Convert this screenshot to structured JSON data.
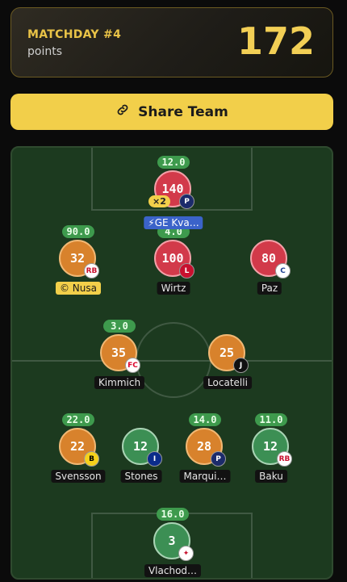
{
  "summary": {
    "matchday": "MATCHDAY #4",
    "label": "points",
    "points": "172"
  },
  "share": {
    "label": "Share Team",
    "icon": "link-icon"
  },
  "players": [
    {
      "id": "gk",
      "name": "Vlachod…",
      "score": "3",
      "top": "16.0",
      "color": "green",
      "badge": "sevilla"
    },
    {
      "id": "d1",
      "name": "Svensson",
      "score": "22",
      "top": "22.0",
      "color": "orange",
      "badge": "bvb"
    },
    {
      "id": "d2",
      "name": "Stones",
      "score": "12",
      "top": "",
      "color": "green",
      "badge": "inter"
    },
    {
      "id": "d3",
      "name": "Marqui…",
      "score": "28",
      "top": "14.0",
      "color": "orange",
      "badge": "psg"
    },
    {
      "id": "d4",
      "name": "Baku",
      "score": "12",
      "top": "11.0",
      "color": "green",
      "badge": "rbl"
    },
    {
      "id": "m1",
      "name": "Kimmich",
      "score": "35",
      "top": "3.0",
      "color": "orange",
      "badge": "bayern"
    },
    {
      "id": "m2",
      "name": "Locatelli",
      "score": "25",
      "top": "",
      "color": "orange",
      "badge": "juve"
    },
    {
      "id": "a1",
      "name": "© Nusa",
      "score": "32",
      "top": "90.0",
      "color": "orange",
      "badge": "rbl"
    },
    {
      "id": "a2",
      "name": "Wirtz",
      "score": "100",
      "top": "4.0",
      "color": "red",
      "badge": "liverpool"
    },
    {
      "id": "a3",
      "name": "Paz",
      "score": "80",
      "top": "",
      "color": "red",
      "badge": "como"
    },
    {
      "id": "f1",
      "name": "⚡GE Kva…",
      "score": "140",
      "top": "12.0",
      "color": "red",
      "badge": "psg",
      "mult": "×2"
    }
  ],
  "colors": {
    "accent": "#f2cf4a",
    "pitch": "#1c3a1f",
    "positive": "#3e9a4d"
  }
}
